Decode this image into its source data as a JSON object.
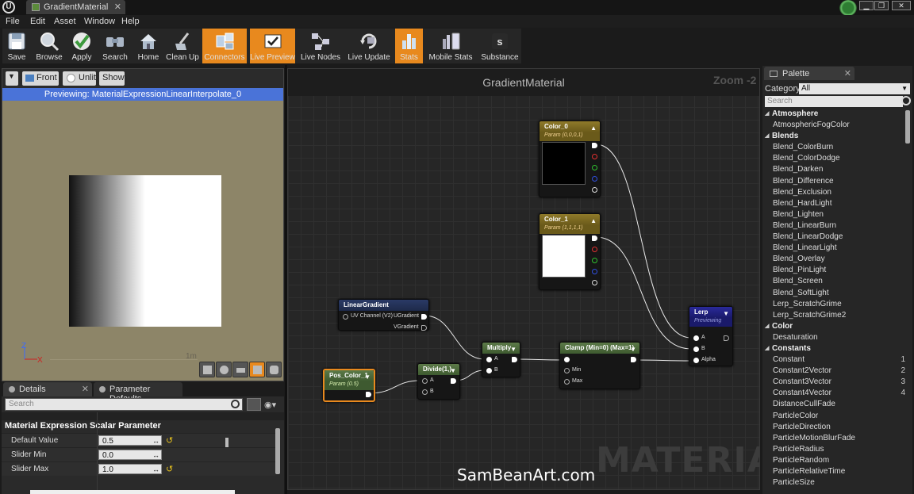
{
  "window": {
    "tab_title": "GradientMaterial",
    "tab_close": "✕",
    "logo_glyph": "U",
    "controls": [
      "▁",
      "❐",
      "✕"
    ]
  },
  "menu": [
    "File",
    "Edit",
    "Asset",
    "Window",
    "Help"
  ],
  "toolbar": [
    {
      "label": "Save",
      "icon": "save-icon",
      "active": false
    },
    {
      "label": "Browse",
      "icon": "browse-icon",
      "active": false
    },
    {
      "label": "Apply",
      "icon": "apply-icon",
      "active": false
    },
    {
      "label": "Search",
      "icon": "search-icon",
      "active": false
    },
    {
      "label": "Home",
      "icon": "home-icon",
      "active": false
    },
    {
      "label": "Clean Up",
      "icon": "clean-up-icon",
      "active": false
    },
    {
      "label": "Connectors",
      "icon": "connectors-icon",
      "active": true
    },
    {
      "label": "Live Preview",
      "icon": "live-preview-icon",
      "active": true
    },
    {
      "label": "Live Nodes",
      "icon": "live-nodes-icon",
      "active": false
    },
    {
      "label": "Live Update",
      "icon": "live-update-icon",
      "active": false
    },
    {
      "label": "Stats",
      "icon": "stats-icon",
      "active": true
    },
    {
      "label": "Mobile Stats",
      "icon": "mobile-stats-icon",
      "active": false
    },
    {
      "label": "Substance",
      "icon": "substance-icon",
      "active": false
    }
  ],
  "viewport": {
    "menu_glyph": "▼",
    "front_label": "Front",
    "unlit_label": "Unlit",
    "show_label": "Show",
    "preview_banner": "Previewing: MaterialExpressionLinearInterpolate_0",
    "axis_z": "Z",
    "axis_x": "X",
    "scale_label": "1m"
  },
  "details": {
    "tab_details": "Details",
    "tab_params": "Parameter Defaults",
    "tab_close": "✕",
    "search_placeholder": "Search",
    "eye_glyph": "◉▾",
    "category": "Material Expression Scalar Parameter",
    "properties": [
      {
        "label": "Default Value",
        "value": "0.5",
        "reset": "↺"
      },
      {
        "label": "Slider Min",
        "value": "0.0",
        "reset": ""
      },
      {
        "label": "Slider Max",
        "value": "1.0",
        "reset": "↺"
      }
    ],
    "arrows_glyph": "↔"
  },
  "graph": {
    "title": "GradientMaterial",
    "zoom": "Zoom -2",
    "watermark": "MATERIAL",
    "credit": "SamBeanArt.com",
    "nodes": {
      "color0": {
        "title": "Color_0",
        "subtitle": "Param (0,0,0,1)",
        "swatch": "#000000"
      },
      "color1": {
        "title": "Color_1",
        "subtitle": "Param (1,1,1,1)",
        "swatch": "#ffffff"
      },
      "linear_gradient": {
        "title": "LinearGradient",
        "input": "UV Channel (V2)",
        "out1": "UGradient",
        "out2": "VGradient"
      },
      "pos_color": {
        "title": "Pos_Color_1",
        "subtitle": "Param (0.5)"
      },
      "divide": {
        "title": "Divide(1,)",
        "in_a": "A",
        "in_b": "B"
      },
      "multiply": {
        "title": "Multiply",
        "in_a": "A",
        "in_b": "B"
      },
      "clamp": {
        "title": "Clamp (Min=0) (Max=1)",
        "in_min": "Min",
        "in_max": "Max"
      },
      "lerp": {
        "title": "Lerp",
        "subtitle": "Previewing",
        "in_a": "A",
        "in_b": "B",
        "in_alpha": "Alpha"
      }
    },
    "collapse_glyph": "▲",
    "expand_glyph": "▼"
  },
  "palette": {
    "tab_title": "Palette",
    "tab_close": "✕",
    "category_label": "Category:",
    "category_value": "All",
    "search_placeholder": "Search",
    "rows": [
      {
        "type": "cat",
        "label": "Atmosphere"
      },
      {
        "type": "item",
        "label": "AtmosphericFogColor"
      },
      {
        "type": "cat",
        "label": "Blends"
      },
      {
        "type": "item",
        "label": "Blend_ColorBurn"
      },
      {
        "type": "item",
        "label": "Blend_ColorDodge"
      },
      {
        "type": "item",
        "label": "Blend_Darken"
      },
      {
        "type": "item",
        "label": "Blend_Difference"
      },
      {
        "type": "item",
        "label": "Blend_Exclusion"
      },
      {
        "type": "item",
        "label": "Blend_HardLight"
      },
      {
        "type": "item",
        "label": "Blend_Lighten"
      },
      {
        "type": "item",
        "label": "Blend_LinearBurn"
      },
      {
        "type": "item",
        "label": "Blend_LinearDodge"
      },
      {
        "type": "item",
        "label": "Blend_LinearLight"
      },
      {
        "type": "item",
        "label": "Blend_Overlay"
      },
      {
        "type": "item",
        "label": "Blend_PinLight"
      },
      {
        "type": "item",
        "label": "Blend_Screen"
      },
      {
        "type": "item",
        "label": "Blend_SoftLight"
      },
      {
        "type": "item",
        "label": "Lerp_ScratchGrime"
      },
      {
        "type": "item",
        "label": "Lerp_ScratchGrime2"
      },
      {
        "type": "cat",
        "label": "Color"
      },
      {
        "type": "item",
        "label": "Desaturation"
      },
      {
        "type": "cat",
        "label": "Constants"
      },
      {
        "type": "item",
        "label": "Constant",
        "hotkey": "1"
      },
      {
        "type": "item",
        "label": "Constant2Vector",
        "hotkey": "2"
      },
      {
        "type": "item",
        "label": "Constant3Vector",
        "hotkey": "3"
      },
      {
        "type": "item",
        "label": "Constant4Vector",
        "hotkey": "4"
      },
      {
        "type": "item",
        "label": "DistanceCullFade"
      },
      {
        "type": "item",
        "label": "ParticleColor"
      },
      {
        "type": "item",
        "label": "ParticleDirection"
      },
      {
        "type": "item",
        "label": "ParticleMotionBlurFade"
      },
      {
        "type": "item",
        "label": "ParticleRadius"
      },
      {
        "type": "item",
        "label": "ParticleRandom"
      },
      {
        "type": "item",
        "label": "ParticleRelativeTime"
      },
      {
        "type": "item",
        "label": "ParticleSize"
      }
    ]
  },
  "colors": {
    "accent_orange": "#e8891e",
    "preview_blue": "#4a73d8",
    "viewport_bg": "#8d8568"
  }
}
